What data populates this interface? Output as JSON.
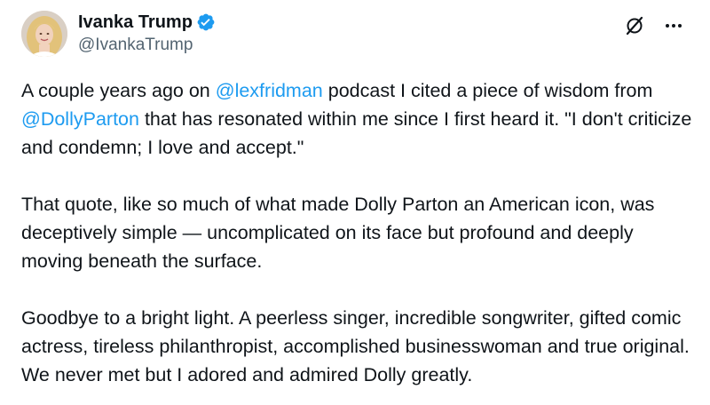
{
  "author": {
    "display_name": "Ivanka Trump",
    "handle": "@IvankaTrump",
    "verified": true,
    "verified_color": "#1d9bf0"
  },
  "actions": {
    "grok_icon": "grok-icon",
    "more_icon": "more-icon"
  },
  "colors": {
    "mention": "#1d9bf0",
    "text": "#0f1419",
    "secondary": "#536471"
  },
  "tweet": {
    "p1": {
      "a": "A couple years ago on ",
      "mention1": "@lexfridman",
      "b": " podcast I cited a piece of wisdom from ",
      "mention2": "@DollyParton",
      "c": " that has resonated within me since I first heard it. \"I don't criticize and condemn; I love and accept.\""
    },
    "p2": "That quote, like so much of what made Dolly Parton an American icon, was deceptively simple — uncomplicated on its face but profound and deeply moving beneath the surface.",
    "p3": "Goodbye to a bright light. A peerless singer, incredible songwriter, gifted comic actress, tireless philanthropist, accomplished businesswoman and true original. We never met but I adored and admired Dolly greatly."
  }
}
